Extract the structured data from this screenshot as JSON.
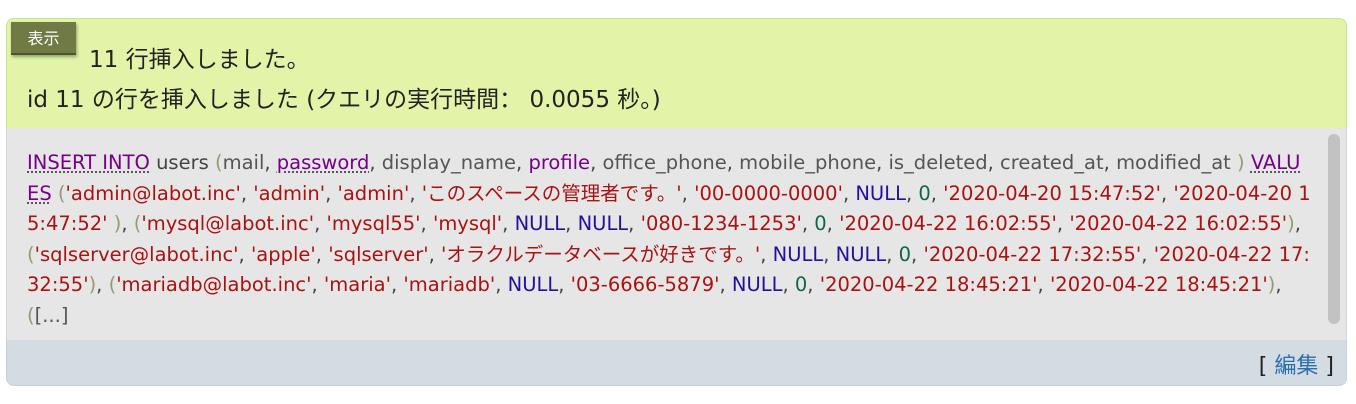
{
  "message": {
    "badge": "表示",
    "line1": "11 行挿入しました。",
    "line2": "id 11 の行を挿入しました (クエリの実行時間： 0.0055 秒。)"
  },
  "sql": {
    "insert_into": "INSERT INTO",
    "table": "users",
    "columns": [
      "mail",
      "password",
      "display_name",
      "profile",
      "office_phone",
      "mobile_phone",
      "is_deleted",
      "created_at",
      "modified_at"
    ],
    "values_kw": "VALUES",
    "rows": [
      [
        "'admin@labot.inc'",
        "'admin'",
        "'admin'",
        "'このスペースの管理者です。'",
        "'00-0000-0000'",
        "NULL",
        "0",
        "'2020-04-20 15:47:52'",
        "'2020-04-20 15:47:52'"
      ],
      [
        "'mysql@labot.inc'",
        "'mysql55'",
        "'mysql'",
        "NULL",
        "NULL",
        "'080-1234-1253'",
        "0",
        "'2020-04-22 16:02:55'",
        "'2020-04-22 16:02:55'"
      ],
      [
        "'sqlserver@labot.inc'",
        "'apple'",
        "'sqlserver'",
        "'オラクルデータベースが好きです。'",
        "NULL",
        "NULL",
        "0",
        "'2020-04-22 17:32:55'",
        "'2020-04-22 17:32:55'"
      ],
      [
        "'mariadb@labot.inc'",
        "'maria'",
        "'mariadb'",
        "NULL",
        "'03-6666-5879'",
        "NULL",
        "0",
        "'2020-04-22 18:45:21'",
        "'2020-04-22 18:45:21'"
      ]
    ],
    "ellipsis": "[...]"
  },
  "footer": {
    "bracket_open": "[",
    "edit_label": "編集",
    "bracket_close": "]"
  },
  "colors": {
    "success_bg": "#e3f4a9",
    "badge_bg": "#6f7a44",
    "sql_bg": "#e6e6e6",
    "footer_bg": "#d3dce3",
    "keyword": "#770088",
    "string": "#aa1111",
    "null": "#221199",
    "number": "#116644",
    "link": "#2a6fb0"
  }
}
